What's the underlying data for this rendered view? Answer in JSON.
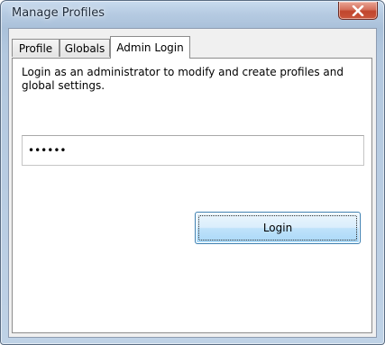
{
  "window": {
    "title": "Manage Profiles"
  },
  "tabs": [
    {
      "label": "Profile"
    },
    {
      "label": "Globals"
    },
    {
      "label": "Admin Login"
    }
  ],
  "admin_login": {
    "description": "Login as an administrator to modify and create profiles and global settings.",
    "password_value": "••••••",
    "login_label": "Login"
  },
  "icons": {
    "close": "close-icon"
  },
  "colors": {
    "close_button": "#c9553b",
    "login_button_border": "#3c7fb1"
  }
}
